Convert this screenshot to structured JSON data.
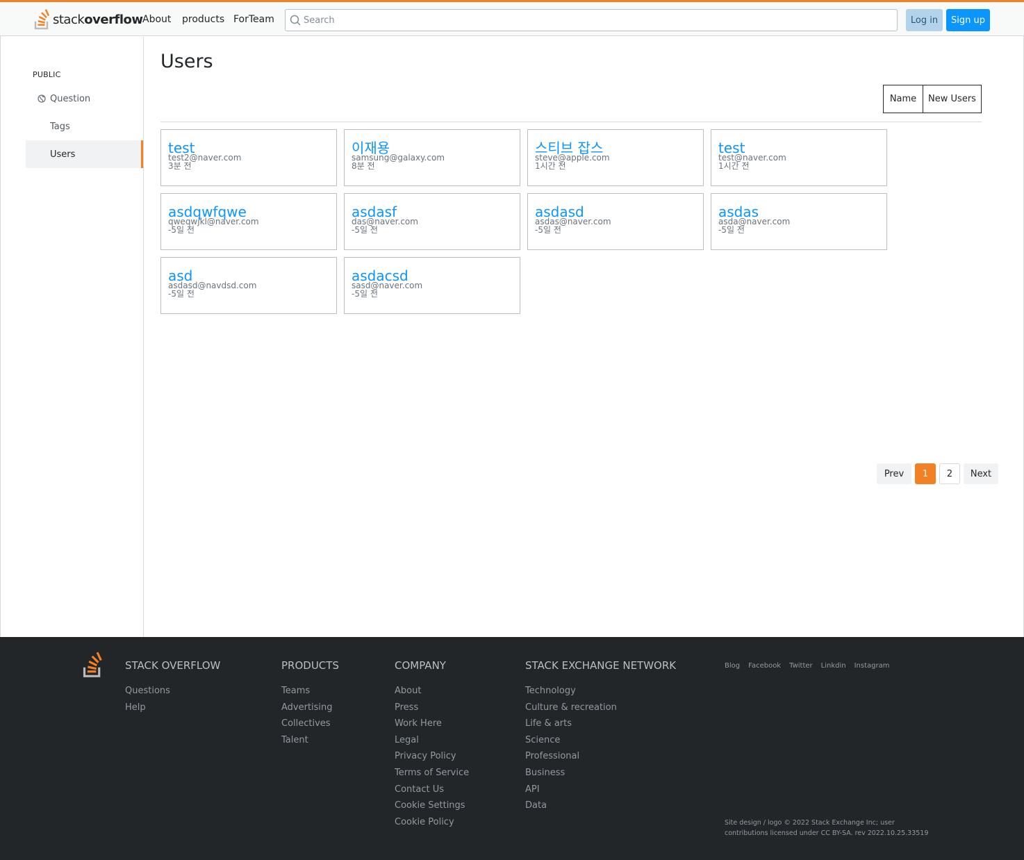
{
  "header": {
    "logo_light": "stack",
    "logo_bold": "overflow",
    "nav": [
      "About",
      "products",
      "ForTeam"
    ],
    "search_placeholder": "Search",
    "login_label": "Log in",
    "signup_label": "Sign up",
    "accent_color": "#f48024",
    "primary_color": "#0a95ff"
  },
  "sidebar": {
    "heading": "PUBLIC",
    "items": [
      {
        "label": "Question",
        "icon": "globe-icon"
      },
      {
        "label": "Tags"
      },
      {
        "label": "Users",
        "active": true
      }
    ]
  },
  "main": {
    "title": "Users",
    "filters": [
      "Name",
      "New Users"
    ],
    "users": [
      {
        "name": "test",
        "email": "test2@naver.com",
        "time": "3분 전"
      },
      {
        "name": "이재용",
        "email": "samsung@galaxy.com",
        "time": "8분 전"
      },
      {
        "name": "스티브 잡스",
        "email": "steve@apple.com",
        "time": "1시간 전"
      },
      {
        "name": "test",
        "email": "test@naver.com",
        "time": "1시간 전"
      },
      {
        "name": "asdqwfqwe",
        "email": "qweqwjkl@naver.com",
        "time": "-5일 전"
      },
      {
        "name": "asdasf",
        "email": "das@naver.com",
        "time": "-5일 전"
      },
      {
        "name": "asdasd",
        "email": "asdas@naver.com",
        "time": "-5일 전"
      },
      {
        "name": "asdas",
        "email": "asda@naver.com",
        "time": "-5일 전"
      },
      {
        "name": "asd",
        "email": "asdasd@navdsd.com",
        "time": "-5일 전"
      },
      {
        "name": "asdacsd",
        "email": "sasd@naver.com",
        "time": "-5일 전"
      }
    ],
    "pagination": {
      "prev": "Prev",
      "pages": [
        "1",
        "2"
      ],
      "current": "1",
      "next": "Next"
    }
  },
  "footer": {
    "columns": [
      {
        "heading": "STACK OVERFLOW",
        "links": [
          "Questions",
          "Help"
        ]
      },
      {
        "heading": "PRODUCTS",
        "links": [
          "Teams",
          "Advertising",
          "Collectives",
          "Talent"
        ]
      },
      {
        "heading": "COMPANY",
        "links": [
          "About",
          "Press",
          "Work Here",
          "Legal",
          "Privacy Policy",
          "Terms of Service",
          "Contact Us",
          "Cookie Settings",
          "Cookie Policy"
        ]
      },
      {
        "heading": "STACK EXCHANGE NETWORK",
        "links": [
          "Technology",
          "Culture & recreation",
          "Life & arts",
          "Science",
          "Professional",
          "Business",
          "API",
          "Data"
        ]
      }
    ],
    "social": [
      "Blog",
      "Facebook",
      "Twitter",
      "Linkdin",
      "Instagram"
    ],
    "copyright": "Site design / logo © 2022 Stack Exchange Inc; user contributions licensed under CC BY-SA. rev 2022.10.25.33519"
  }
}
